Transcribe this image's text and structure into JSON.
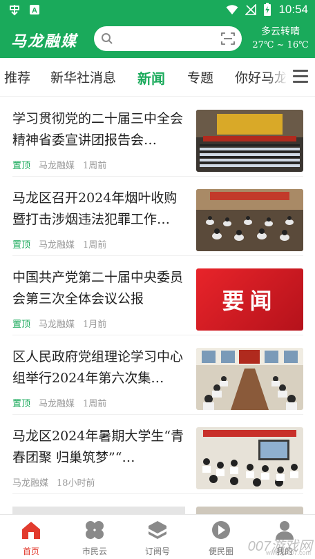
{
  "status_bar": {
    "time": "10:54"
  },
  "header": {
    "logo": "马龙融媒",
    "search_placeholder": "",
    "weather": {
      "condition": "多云转晴",
      "temperature": "27℃ ~ 16℃"
    }
  },
  "tabs": [
    {
      "label": "推荐"
    },
    {
      "label": "新华社消息"
    },
    {
      "label": "新闻",
      "active": true
    },
    {
      "label": "专题"
    },
    {
      "label": "你好马龙"
    }
  ],
  "news": [
    {
      "title": "学习贯彻党的二十届三中全会精神省委宣讲团报告会…",
      "pin": "置顶",
      "source": "马龙融媒",
      "time": "1周前",
      "thumb": "meeting-hall-red"
    },
    {
      "title": "马龙区召开2024年烟叶收购暨打击涉烟违法犯罪工作…",
      "pin": "置顶",
      "source": "马龙融媒",
      "time": "1周前",
      "thumb": "conference-room"
    },
    {
      "title": "中国共产党第二十届中央委员会第三次全体会议公报",
      "pin": "置顶",
      "source": "马龙融媒",
      "time": "1月前",
      "thumb": "yaowen-banner",
      "thumb_text": "要闻"
    },
    {
      "title": "区人民政府党组理论学习中心组举行2024年第六次集…",
      "pin": "置顶",
      "source": "马龙融媒",
      "time": "1周前",
      "thumb": "study-meeting"
    },
    {
      "title": "马龙区2024年暑期大学生“青春团聚 归巢筑梦”“…",
      "pin": "",
      "source": "马龙融媒",
      "time": "18小时前",
      "thumb": "student-gathering"
    }
  ],
  "bottom_nav": [
    {
      "label": "首页",
      "icon": "home-icon",
      "active": true
    },
    {
      "label": "市民云",
      "icon": "clover-icon"
    },
    {
      "label": "订阅号",
      "icon": "subscribe-icon"
    },
    {
      "label": "便民圈",
      "icon": "circle-icon"
    },
    {
      "label": "我的",
      "icon": "user-icon"
    }
  ],
  "watermark": {
    "brand": "007游戏网",
    "url": "www.yx007.com"
  },
  "colors": {
    "brand_green": "#1aaa5b",
    "active_red": "#e23b2e",
    "pin_green": "#1aaa5b"
  }
}
